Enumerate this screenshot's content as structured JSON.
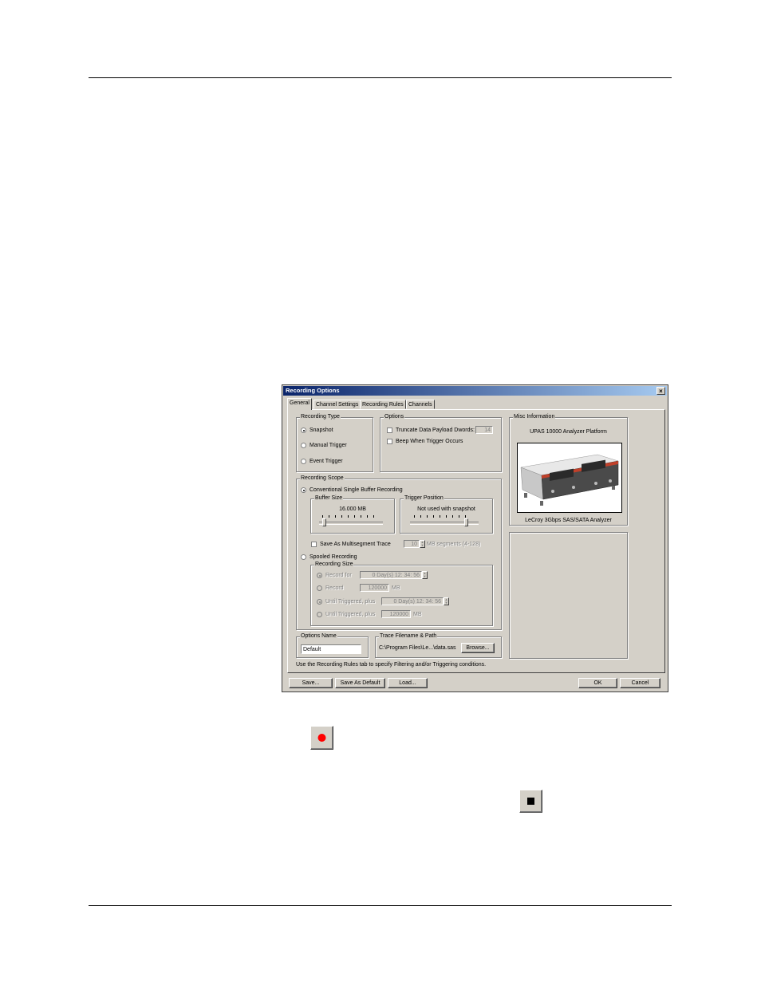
{
  "dialog": {
    "title": "Recording Options",
    "tabs": [
      "General",
      "Channel Settings",
      "Recording Rules",
      "Channels"
    ],
    "recording_type": {
      "label": "Recording Type",
      "options": [
        "Snapshot",
        "Manual Trigger",
        "Event Trigger"
      ],
      "selected": "Snapshot"
    },
    "options": {
      "label": "Options",
      "truncate_label": "Truncate Data Payload Dwords:",
      "truncate_value": "14",
      "beep_label": "Beep When Trigger Occurs"
    },
    "misc_info": {
      "label": "Misc Information",
      "platform": "UPAS 10000 Analyzer Platform",
      "analyzer": "LeCroy 3Gbps SAS/SATA Analyzer"
    },
    "recording_scope": {
      "label": "Recording Scope",
      "conventional": "Conventional Single Buffer Recording",
      "buffer_size_label": "Buffer Size",
      "buffer_size_value": "16.000 MB",
      "trigger_position_label": "Trigger Position",
      "trigger_position_value": "Not used with snapshot",
      "multisegment_label": "Save As Multisegment Trace",
      "multisegment_value": "10",
      "multisegment_suffix": "MB segments (4-128)",
      "spooled": "Spooled Recording",
      "recording_size_label": "Recording Size",
      "record_for": "Record for",
      "record_for_value": "0 Day(s) 12: 34: 56",
      "record": "Record",
      "record_value": "120000",
      "record_unit": "MB",
      "until_triggered_time": "Until Triggered, plus",
      "until_triggered_time_value": "0 Day(s) 12: 34: 56",
      "until_triggered_mb": "Until Triggered, plus",
      "until_triggered_mb_value": "120000",
      "until_triggered_mb_unit": "MB"
    },
    "options_name": {
      "label": "Options Name",
      "value": "Default"
    },
    "trace": {
      "label": "Trace Filename & Path",
      "path": "C:\\Program Files\\Le...\\data.sas",
      "browse": "Browse..."
    },
    "hint": "Use the Recording Rules tab to specify Filtering and/or Triggering conditions.",
    "buttons": {
      "save": "Save...",
      "save_default": "Save As Default",
      "load": "Load...",
      "ok": "OK",
      "cancel": "Cancel"
    }
  },
  "icons": [
    "record-icon",
    "stop-icon"
  ],
  "colors": {
    "title_bar": "#0a246a",
    "record_dot": "#ff0000",
    "dialog_face": "#d4d0c8"
  }
}
